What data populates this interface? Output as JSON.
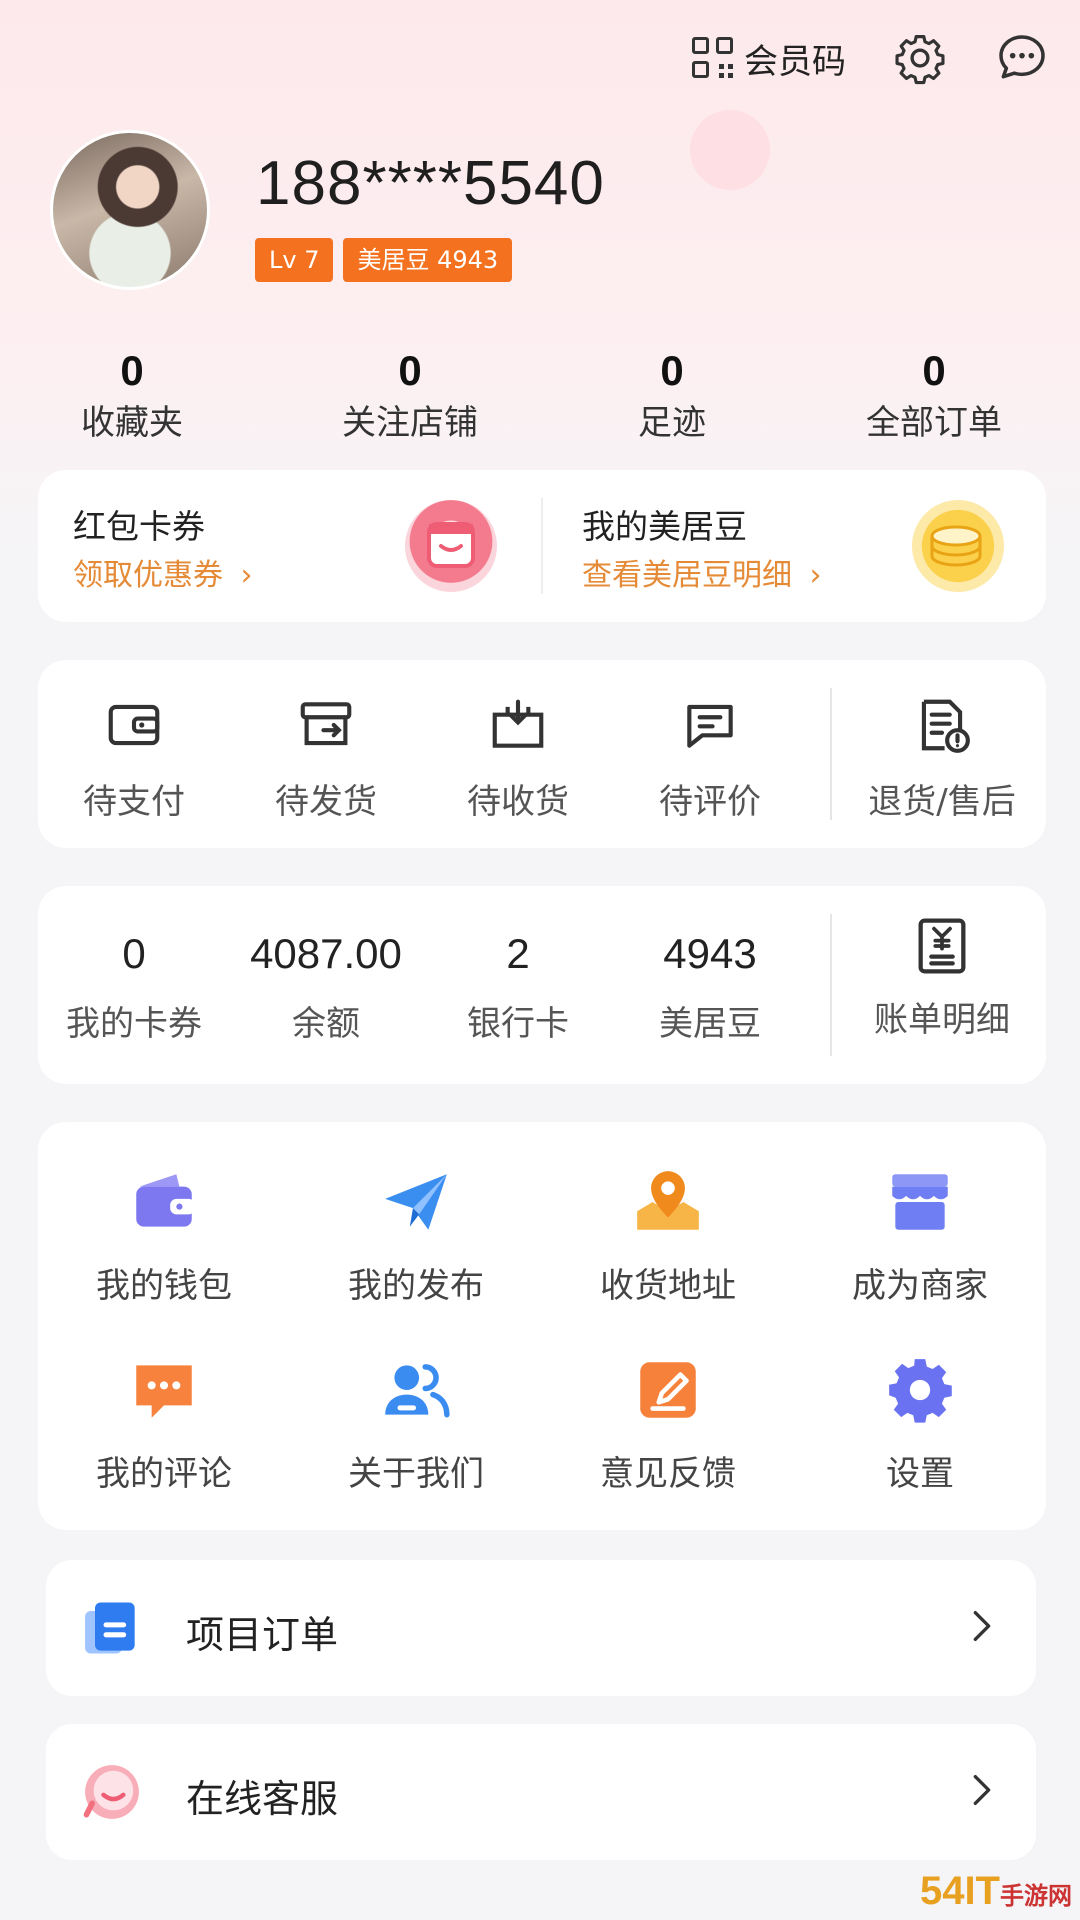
{
  "topbar": {
    "member_code": "会员码"
  },
  "profile": {
    "phone": "188****5540",
    "level": "Lv 7",
    "beans_badge": "美居豆 4943"
  },
  "stats": [
    {
      "value": "0",
      "label": "收藏夹"
    },
    {
      "value": "0",
      "label": "关注店铺"
    },
    {
      "value": "0",
      "label": "足迹"
    },
    {
      "value": "0",
      "label": "全部订单"
    }
  ],
  "coupon_card": {
    "left_title": "红包卡券",
    "left_link": "领取优惠券",
    "right_title": "我的美居豆",
    "right_link": "查看美居豆明细"
  },
  "orders": [
    {
      "label": "待支付",
      "icon": "wallet-icon"
    },
    {
      "label": "待发货",
      "icon": "box-send-icon"
    },
    {
      "label": "待收货",
      "icon": "box-receive-icon"
    },
    {
      "label": "待评价",
      "icon": "comment-icon"
    },
    {
      "label": "退货/售后",
      "icon": "return-doc-icon"
    }
  ],
  "assets": [
    {
      "value": "0",
      "label": "我的卡券"
    },
    {
      "value": "4087.00",
      "label": "余额"
    },
    {
      "value": "2",
      "label": "银行卡"
    },
    {
      "value": "4943",
      "label": "美居豆"
    }
  ],
  "bill": {
    "label": "账单明细"
  },
  "services": [
    {
      "label": "我的钱包",
      "icon": "wallet-icon",
      "color": "#7d77f0"
    },
    {
      "label": "我的发布",
      "icon": "paper-plane-icon",
      "color": "#3a8ef0"
    },
    {
      "label": "收货地址",
      "icon": "location-pin-icon",
      "color": "#f5a531"
    },
    {
      "label": "成为商家",
      "icon": "store-icon",
      "color": "#6f7ef2"
    },
    {
      "label": "我的评论",
      "icon": "chat-bubble-icon",
      "color": "#f6823d"
    },
    {
      "label": "关于我们",
      "icon": "users-icon",
      "color": "#3b8cf0"
    },
    {
      "label": "意见反馈",
      "icon": "edit-icon",
      "color": "#f5813a"
    },
    {
      "label": "设置",
      "icon": "gear-icon",
      "color": "#6a72f2"
    }
  ],
  "rows": [
    {
      "label": "项目订单"
    },
    {
      "label": "在线客服"
    }
  ],
  "watermark": {
    "main": "54IT",
    "sub": "手游网"
  }
}
